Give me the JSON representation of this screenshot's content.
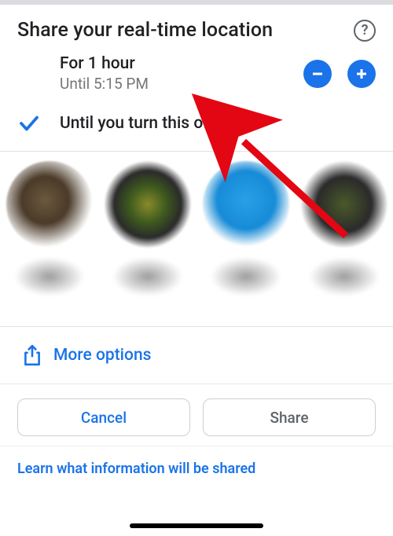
{
  "header": {
    "title": "Share your real-time location",
    "help_label": "?"
  },
  "duration_option": {
    "title": "For 1 hour",
    "subtitle": "Until 5:15 PM",
    "minus_label": "Decrease duration",
    "plus_label": "Increase duration",
    "selected": false
  },
  "until_off_option": {
    "label": "Until you turn this off",
    "selected": true
  },
  "more_options": {
    "label": "More options"
  },
  "buttons": {
    "cancel": "Cancel",
    "share": "Share"
  },
  "footer": {
    "learn_link": "Learn what information will be shared"
  },
  "colors": {
    "accent": "#1a73e8",
    "text_secondary": "#747679"
  },
  "annotation": {
    "arrow_target": "until_off_option"
  }
}
